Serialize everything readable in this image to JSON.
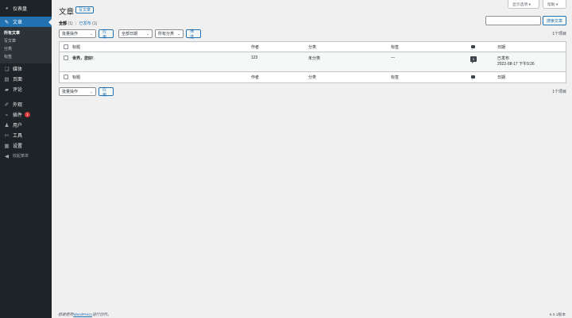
{
  "sidebar": {
    "items": [
      {
        "label": "仪表盘",
        "icon": "dashboard-icon",
        "glyph": "◕"
      },
      {
        "label": "文章",
        "icon": "pin-icon",
        "glyph": "✎"
      },
      {
        "label": "媒体",
        "icon": "media-icon",
        "glyph": "❏"
      },
      {
        "label": "页面",
        "icon": "page-icon",
        "glyph": "▤"
      },
      {
        "label": "评论",
        "icon": "comment-icon",
        "glyph": "▰"
      },
      {
        "label": "外观",
        "icon": "brush-icon",
        "glyph": "✐"
      },
      {
        "label": "插件",
        "icon": "plugin-icon",
        "glyph": "⌁",
        "badge": "1"
      },
      {
        "label": "用户",
        "icon": "user-icon",
        "glyph": "♟"
      },
      {
        "label": "工具",
        "icon": "wrench-icon",
        "glyph": "✄"
      },
      {
        "label": "设置",
        "icon": "settings-icon",
        "glyph": "▦"
      }
    ],
    "submenu": [
      "所有文章",
      "写文章",
      "分类",
      "标签"
    ],
    "collapse_label": "收起菜单"
  },
  "screen_options": "显示选项 ▾",
  "help": "帮助 ▾",
  "header": {
    "title": "文章",
    "add_new": "写文章"
  },
  "filters": {
    "all_label": "全部",
    "all_count": "(1)",
    "published_label": "已发布",
    "published_count": "(1)"
  },
  "search": {
    "placeholder": "",
    "button": "搜索文章"
  },
  "tablenav": {
    "bulk_action": "批量操作",
    "apply": "应用",
    "date_filter": "全部日期",
    "category_filter": "所有分类",
    "filter_button": "筛选",
    "items_count": "1个项目"
  },
  "table": {
    "columns": {
      "title": "标题",
      "author": "作者",
      "categories": "分类",
      "tags": "标签",
      "date": "日期"
    },
    "rows": [
      {
        "title": "世界，您好!",
        "author": "123",
        "categories": "未分类",
        "tags": "—",
        "comments": "1",
        "status": "已发布",
        "date": "2022-08-17 下午9:26"
      }
    ]
  },
  "footer": {
    "credit_prefix": "感谢使用",
    "credit_link": "WordPress",
    "credit_suffix": "进行创作。",
    "version": "6.0.1版本"
  }
}
